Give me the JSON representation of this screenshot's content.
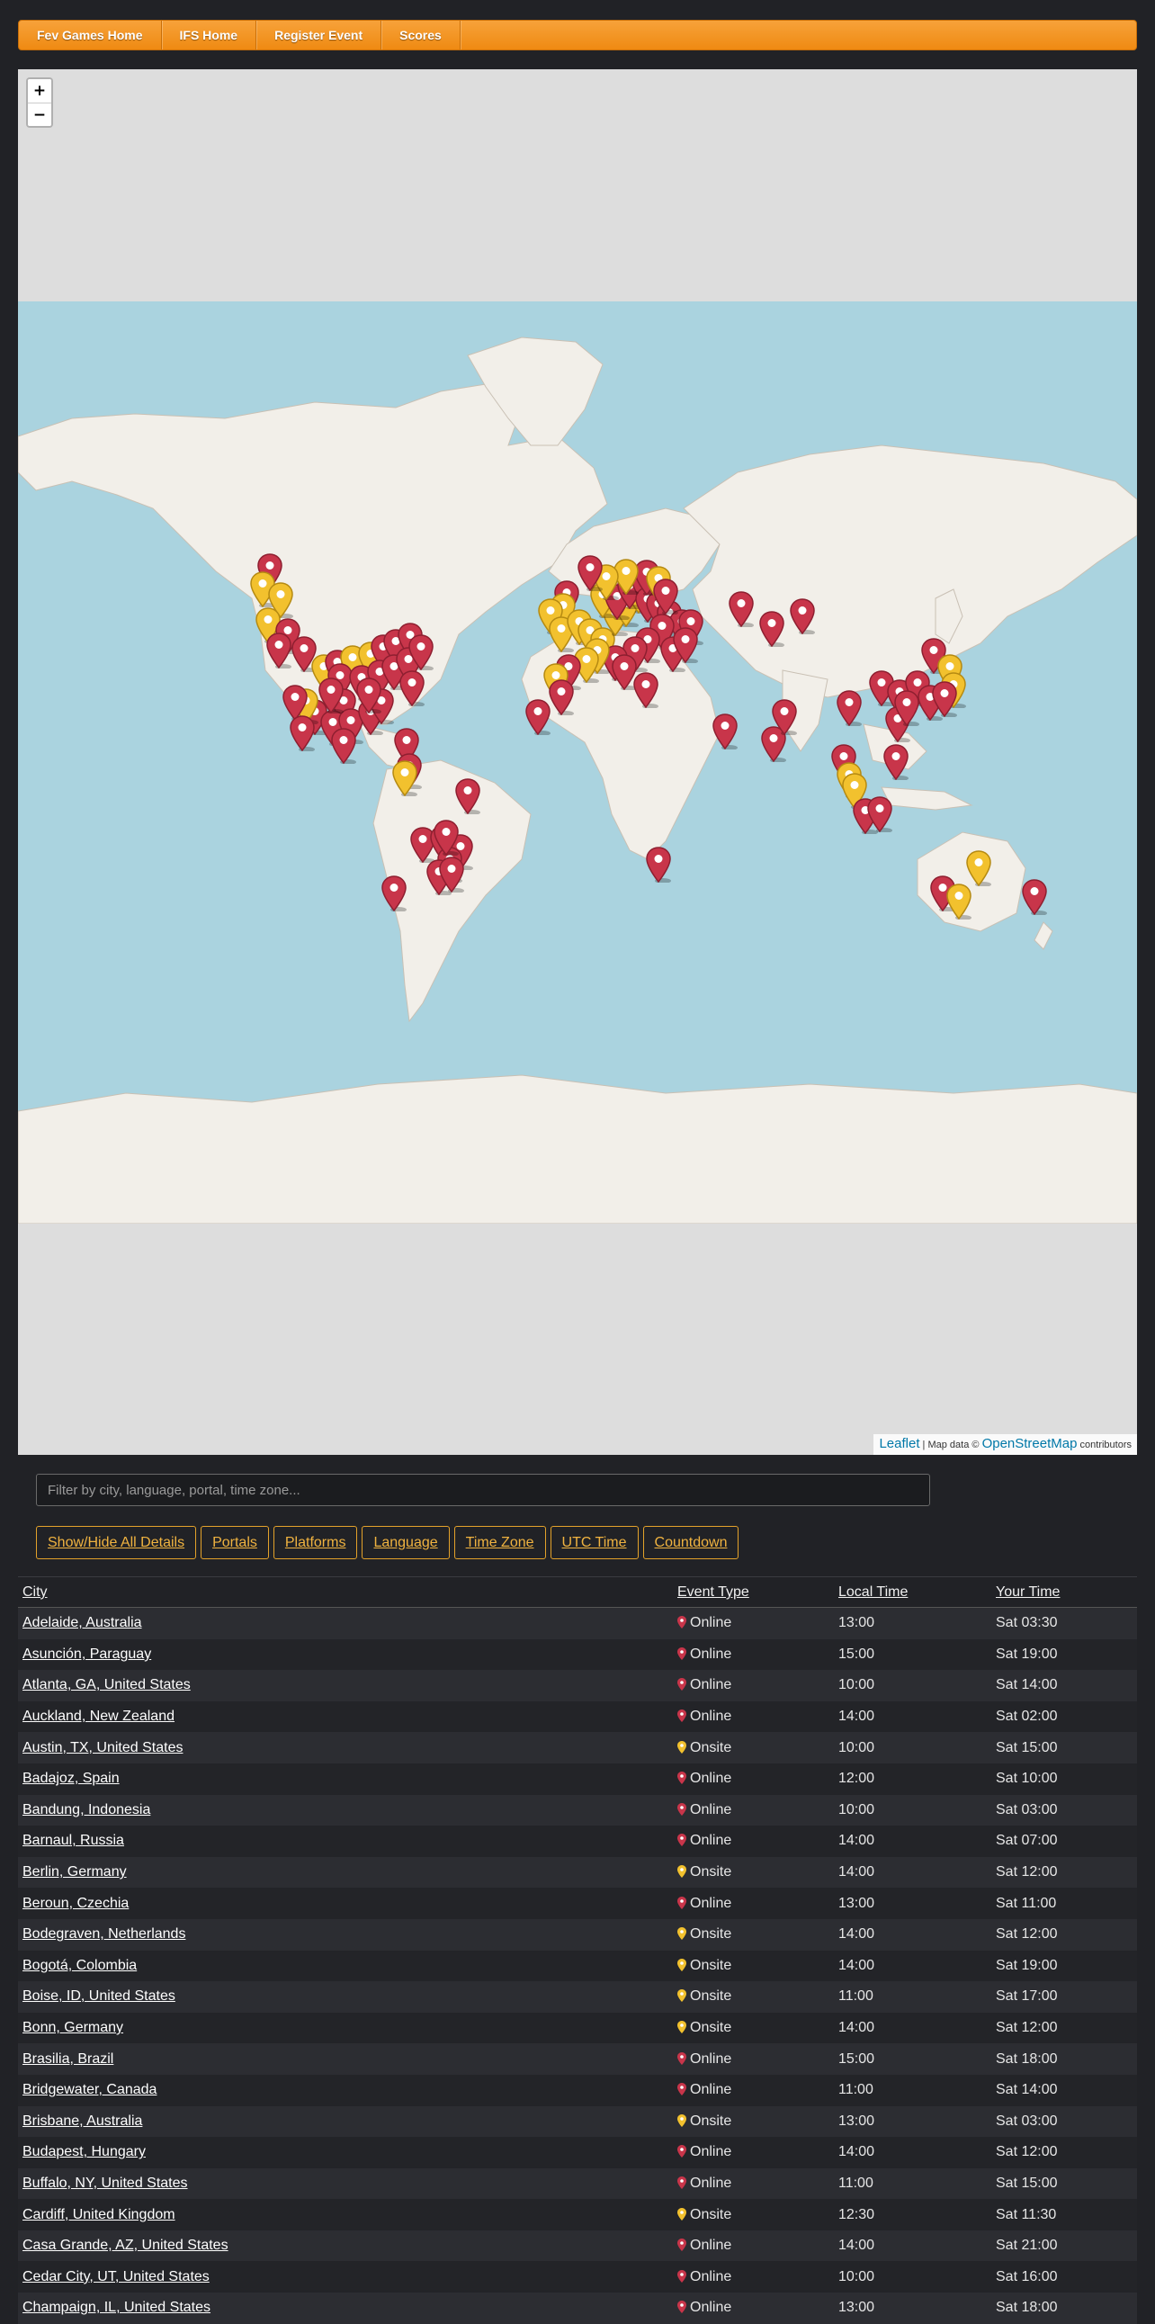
{
  "nav": {
    "items": [
      "Fev Games Home",
      "IFS Home",
      "Register Event",
      "Scores"
    ]
  },
  "map": {
    "zoom_in": "+",
    "zoom_out": "−",
    "attribution": {
      "leaflet": "Leaflet",
      "sep": " | Map data © ",
      "osm": "OpenStreetMap",
      "suffix": " contributors"
    },
    "colors": {
      "online": "#c8354a",
      "onsite": "#f2c12e",
      "water": "#aad3df",
      "land": "#f2efe9"
    }
  },
  "filter": {
    "placeholder": "Filter by city, language, portal, time zone..."
  },
  "buttons": [
    "Show/Hide All Details",
    "Portals",
    "Platforms",
    "Language",
    "Time Zone",
    "UTC Time",
    "Countdown"
  ],
  "table": {
    "headers": {
      "city": "City",
      "event_type": "Event Type",
      "local_time": "Local Time",
      "your_time": "Your Time"
    },
    "rows": [
      {
        "city": "Adelaide, Australia",
        "type": "Online",
        "local": "13:00",
        "yours": "Sat 03:30"
      },
      {
        "city": "Asunción, Paraguay",
        "type": "Online",
        "local": "15:00",
        "yours": "Sat 19:00"
      },
      {
        "city": "Atlanta, GA, United States",
        "type": "Online",
        "local": "10:00",
        "yours": "Sat 14:00"
      },
      {
        "city": "Auckland, New Zealand",
        "type": "Online",
        "local": "14:00",
        "yours": "Sat 02:00"
      },
      {
        "city": "Austin, TX, United States",
        "type": "Onsite",
        "local": "10:00",
        "yours": "Sat 15:00"
      },
      {
        "city": "Badajoz, Spain",
        "type": "Online",
        "local": "12:00",
        "yours": "Sat 10:00"
      },
      {
        "city": "Bandung, Indonesia",
        "type": "Online",
        "local": "10:00",
        "yours": "Sat 03:00"
      },
      {
        "city": "Barnaul, Russia",
        "type": "Online",
        "local": "14:00",
        "yours": "Sat 07:00"
      },
      {
        "city": "Berlin, Germany",
        "type": "Onsite",
        "local": "14:00",
        "yours": "Sat 12:00"
      },
      {
        "city": "Beroun, Czechia",
        "type": "Online",
        "local": "13:00",
        "yours": "Sat 11:00"
      },
      {
        "city": "Bodegraven, Netherlands",
        "type": "Onsite",
        "local": "14:00",
        "yours": "Sat 12:00"
      },
      {
        "city": "Bogotá, Colombia",
        "type": "Onsite",
        "local": "14:00",
        "yours": "Sat 19:00"
      },
      {
        "city": "Boise, ID, United States",
        "type": "Onsite",
        "local": "11:00",
        "yours": "Sat 17:00"
      },
      {
        "city": "Bonn, Germany",
        "type": "Onsite",
        "local": "14:00",
        "yours": "Sat 12:00"
      },
      {
        "city": "Brasilia, Brazil",
        "type": "Online",
        "local": "15:00",
        "yours": "Sat 18:00"
      },
      {
        "city": "Bridgewater, Canada",
        "type": "Online",
        "local": "11:00",
        "yours": "Sat 14:00"
      },
      {
        "city": "Brisbane, Australia",
        "type": "Onsite",
        "local": "13:00",
        "yours": "Sat 03:00"
      },
      {
        "city": "Budapest, Hungary",
        "type": "Online",
        "local": "14:00",
        "yours": "Sat 12:00"
      },
      {
        "city": "Buffalo, NY, United States",
        "type": "Online",
        "local": "11:00",
        "yours": "Sat 15:00"
      },
      {
        "city": "Cardiff, United Kingdom",
        "type": "Onsite",
        "local": "12:30",
        "yours": "Sat 11:30"
      },
      {
        "city": "Casa Grande, AZ, United States",
        "type": "Online",
        "local": "14:00",
        "yours": "Sat 21:00"
      },
      {
        "city": "Cedar City, UT, United States",
        "type": "Online",
        "local": "10:00",
        "yours": "Sat 16:00"
      },
      {
        "city": "Champaign, IL, United States",
        "type": "Online",
        "local": "13:00",
        "yours": "Sat 18:00"
      }
    ]
  }
}
